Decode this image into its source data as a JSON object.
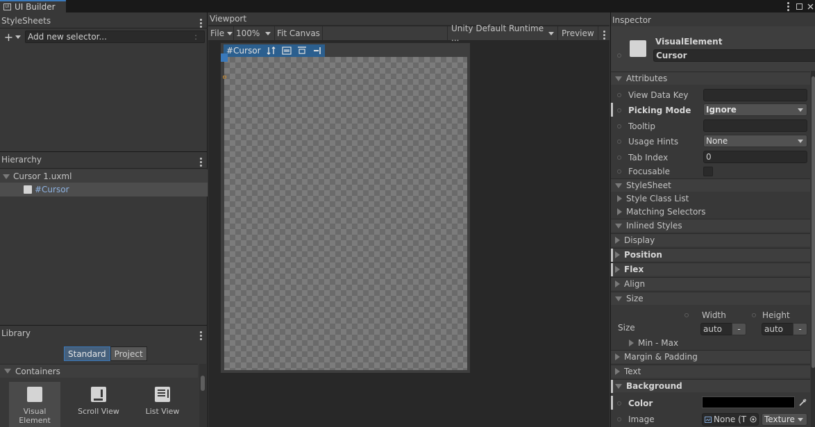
{
  "window": {
    "tab_label": "UI Builder",
    "tab_icon": "ui-builder-icon",
    "controls": [
      "kebab-menu-icon",
      "maximize-icon",
      "close-icon"
    ]
  },
  "stylesheets": {
    "title": "StyleSheets",
    "add_selector_placeholder": "Add new selector...",
    "add_selector_hint": ":"
  },
  "hierarchy": {
    "title": "Hierarchy",
    "document": "Cursor 1.uxml",
    "element": "#Cursor"
  },
  "library": {
    "title": "Library",
    "tabs": [
      {
        "label": "Standard",
        "active": true
      },
      {
        "label": "Project",
        "active": false
      }
    ],
    "category": "Containers",
    "items": [
      {
        "label": "Visual Element",
        "icon": "visual-element-icon",
        "selected": true
      },
      {
        "label": "Scroll View",
        "icon": "scroll-view-icon",
        "selected": false
      },
      {
        "label": "List View",
        "icon": "list-view-icon",
        "selected": false
      }
    ]
  },
  "viewport": {
    "title": "Viewport",
    "toolbar": {
      "file": "File",
      "zoom": "100%",
      "fit": "Fit Canvas",
      "theme": "Unity Default Runtime ...",
      "preview": "Preview"
    },
    "selection_tag": "#Cursor"
  },
  "inspector": {
    "title": "Inspector",
    "element_type": "VisualElement",
    "element_name": "Cursor",
    "attributes": {
      "header": "Attributes",
      "view_data_key_label": "View Data Key",
      "view_data_key": "",
      "picking_mode_label": "Picking Mode",
      "picking_mode": "Ignore",
      "tooltip_label": "Tooltip",
      "tooltip": "",
      "usage_hints_label": "Usage Hints",
      "usage_hints": "None",
      "tab_index_label": "Tab Index",
      "tab_index": "0",
      "focusable_label": "Focusable"
    },
    "stylesheet": {
      "header": "StyleSheet",
      "style_class_list": "Style Class List",
      "matching_selectors": "Matching Selectors"
    },
    "inlined": {
      "header": "Inlined Styles",
      "display": "Display",
      "position": "Position",
      "flex": "Flex",
      "align": "Align",
      "size": "Size",
      "size_label": "Size",
      "width_label": "Width",
      "width": "auto",
      "height_label": "Height",
      "height": "auto",
      "unit_button": "-",
      "min_max": "Min - Max",
      "margin_padding": "Margin & Padding",
      "text": "Text",
      "background": "Background",
      "color_label": "Color",
      "color_value": "#000000",
      "image_label": "Image",
      "image_value": "None (T",
      "image_type": "Texture"
    }
  }
}
